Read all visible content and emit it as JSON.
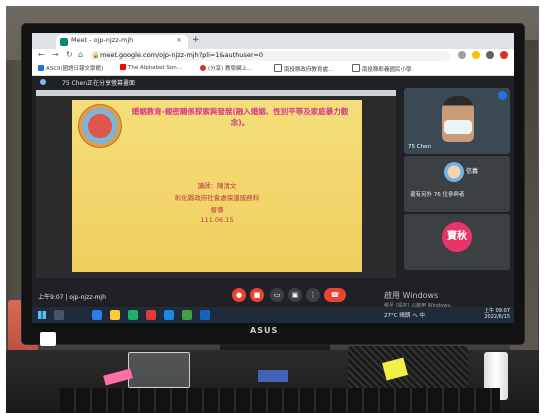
{
  "browser": {
    "tab_title": "Meet - ojp-njzz-mjh",
    "tab_close": "×",
    "new_tab": "+",
    "url": "meet.google.com/ojp-njzz-mjh?pli=1&authuser=0",
    "bookmarks": [
      "ASCII(國語日報文學館)",
      "The Alphabet Son...",
      "(分享) 教學網上...",
      "南投縣政府教育處...",
      "南投縣彰義國民小學"
    ]
  },
  "meet": {
    "presenter_banner": "75 Chen正在分享螢幕畫面",
    "slide": {
      "title": "婚姻教育-親密關係探索與發展(融入婚姻、性別平等及家庭暴力觀念)。",
      "lecturer": "講師：陳清文",
      "org": "彰化縣政府社會處保護服務科",
      "role": "督導",
      "date": "111.06.15"
    },
    "tile_main_label": "75 Chen",
    "tile_two_name": "信義",
    "tile_two_label": "還有另外 76 位參與者",
    "tile_three_initials": "寶秋",
    "time_code": "上午9:07 | ojp-njzz-mjh"
  },
  "windows": {
    "watermark": "啟用 Windows",
    "watermark_sub": "移至 [設定] 以啟用 Windows。",
    "tray": "27°C 晴朗 へ  中",
    "clock_time": "上午 09:07",
    "clock_date": "2022/6/15"
  },
  "brand": "ASUS"
}
